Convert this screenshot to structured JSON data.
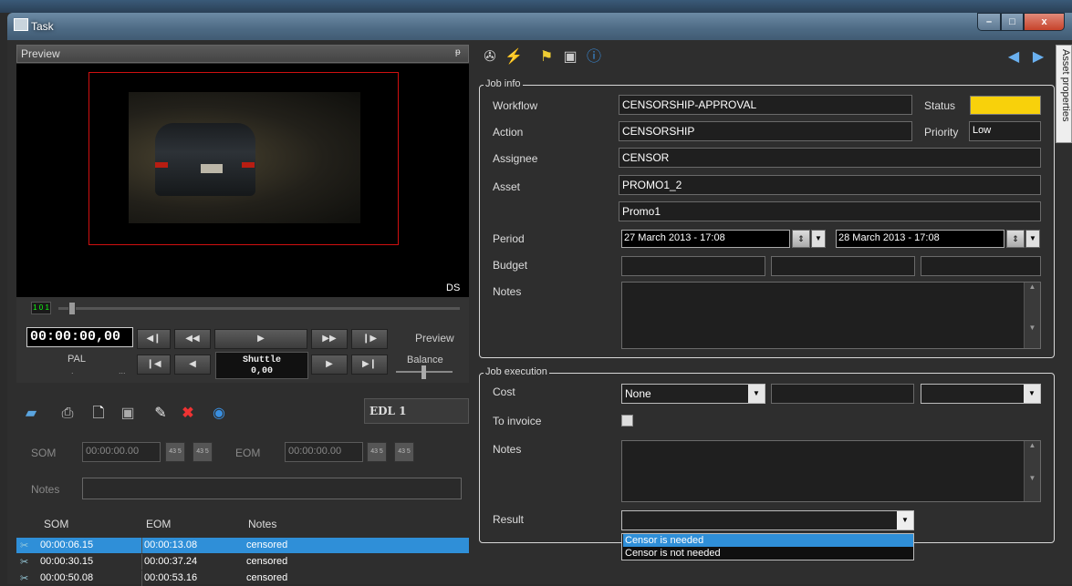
{
  "window": {
    "title": "Task",
    "min_label": "–",
    "max_label": "□",
    "close_label": "x"
  },
  "preview": {
    "title": "Preview",
    "pin_label": "ᵽ",
    "ds_label": "DS",
    "led_label": "1 0 1",
    "timecode": "00:00:00,00",
    "format": "PAL",
    "format_sub": ".",
    "format_dots": "...",
    "shuttle_title": "Shuttle",
    "shuttle_value": "0,00",
    "preview_label": "Preview",
    "balance_label": "Balance"
  },
  "edl": {
    "label": "EDL 1",
    "som_label": "SOM",
    "som_value": "00:00:00.00",
    "eom_label": "EOM",
    "eom_value": "00:00:00.00",
    "notes_label": "Notes",
    "small_btn": "43 5",
    "columns": [
      "SOM",
      "EOM",
      "Notes"
    ],
    "rows": [
      {
        "som": "00:00:06.15",
        "eom": "00:00:13.08",
        "notes": "censored",
        "selected": true
      },
      {
        "som": "00:00:30.15",
        "eom": "00:00:37.24",
        "notes": "censored",
        "selected": false
      },
      {
        "som": "00:00:50.08",
        "eom": "00:00:53.16",
        "notes": "censored",
        "selected": false
      }
    ]
  },
  "side_tab": {
    "label": "Asset properties"
  },
  "job_info": {
    "group_label": "Job info",
    "workflow_label": "Workflow",
    "workflow": "CENSORSHIP-APPROVAL",
    "status_label": "Status",
    "status_color": "#f8d10b",
    "action_label": "Action",
    "action": "CENSORSHIP",
    "priority_label": "Priority",
    "priority": "Low",
    "assignee_label": "Assignee",
    "assignee": "CENSOR",
    "asset_label": "Asset",
    "asset": "PROMO1_2",
    "asset_name": "Promo1",
    "period_label": "Period",
    "period_start": "27 March 2013 - 17:08",
    "period_end": "28 March 2013 - 17:08",
    "budget_label": "Budget",
    "notes_label": "Notes"
  },
  "job_execution": {
    "group_label": "Job execution",
    "cost_label": "Cost",
    "cost_value": "None",
    "to_invoice_label": "To invoice",
    "notes_label": "Notes",
    "result_label": "Result",
    "result_value": "",
    "result_options": [
      "Censor is needed",
      "Censor is not needed"
    ]
  },
  "icons": {
    "preview_toolbar": [
      "step-back-icon",
      "rewind-icon",
      "play-icon",
      "fast-forward-icon",
      "step-forward-icon",
      "go-start-icon",
      "prev-frame-icon",
      "next-frame-icon",
      "go-end-icon"
    ],
    "edl_toolbar": [
      "open-icon",
      "print-icon",
      "add-icon",
      "save-icon",
      "edit-icon",
      "delete-icon",
      "play-circle-icon"
    ],
    "right_toolbar": [
      "film-icon",
      "wizard-icon",
      "flag-icon",
      "save-icon",
      "info-icon",
      "back-arrow-icon",
      "forward-arrow-icon"
    ]
  }
}
